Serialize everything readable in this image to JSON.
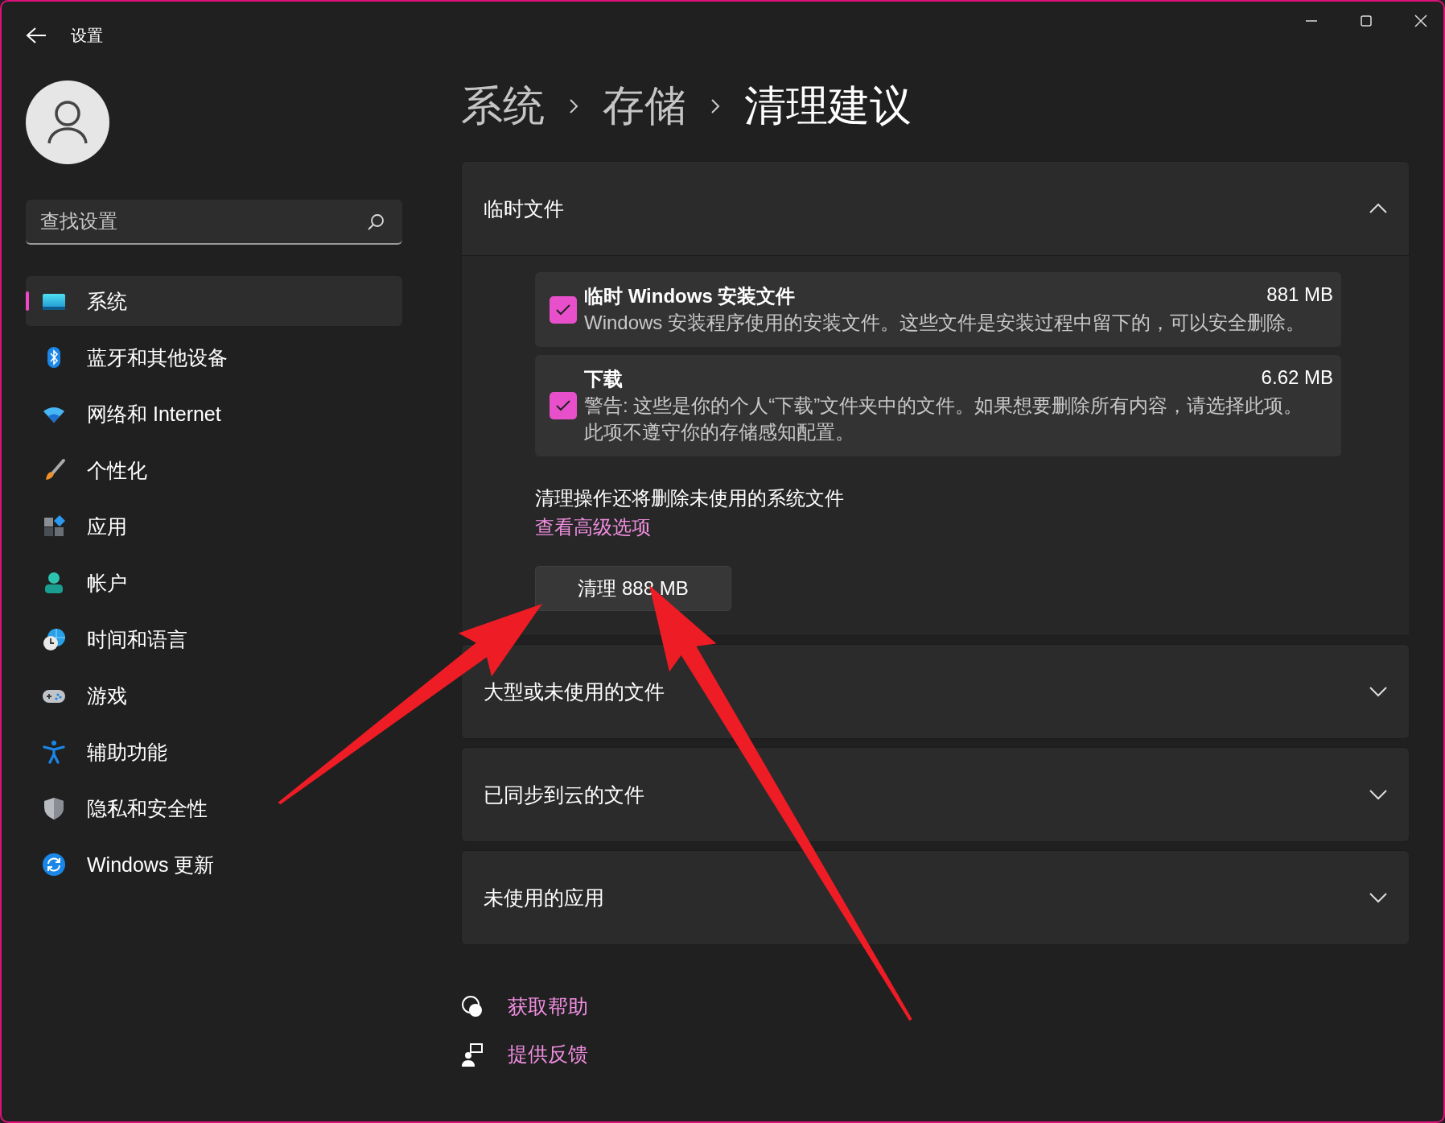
{
  "window": {
    "title": "设置"
  },
  "search": {
    "placeholder": "查找设置"
  },
  "sidebar": {
    "items": [
      {
        "label": "系统",
        "selected": true
      },
      {
        "label": "蓝牙和其他设备",
        "selected": false
      },
      {
        "label": "网络和 Internet",
        "selected": false
      },
      {
        "label": "个性化",
        "selected": false
      },
      {
        "label": "应用",
        "selected": false
      },
      {
        "label": "帐户",
        "selected": false
      },
      {
        "label": "时间和语言",
        "selected": false
      },
      {
        "label": "游戏",
        "selected": false
      },
      {
        "label": "辅助功能",
        "selected": false
      },
      {
        "label": "隐私和安全性",
        "selected": false
      },
      {
        "label": "Windows 更新",
        "selected": false
      }
    ]
  },
  "breadcrumb": [
    {
      "label": "系统",
      "current": false
    },
    {
      "label": "存储",
      "current": false
    },
    {
      "label": "清理建议",
      "current": true
    }
  ],
  "sections": [
    {
      "title": "临时文件",
      "expanded": true,
      "items": [
        {
          "title": "临时 Windows 安装文件",
          "size": "881 MB",
          "description": "Windows 安装程序使用的安装文件。这些文件是安装过程中留下的，可以安全删除。",
          "checked": true
        },
        {
          "title": "下载",
          "size": "6.62 MB",
          "description": "警告: 这些是你的个人“下载”文件夹中的文件。如果想要删除所有内容，请选择此项。此项不遵守你的存储感知配置。",
          "checked": true
        }
      ],
      "note": "清理操作还将删除未使用的系统文件",
      "link": "查看高级选项",
      "button": "清理 888 MB"
    },
    {
      "title": "大型或未使用的文件",
      "expanded": false
    },
    {
      "title": "已同步到云的文件",
      "expanded": false
    },
    {
      "title": "未使用的应用",
      "expanded": false
    }
  ],
  "footer_links": [
    "获取帮助",
    "提供反馈"
  ]
}
